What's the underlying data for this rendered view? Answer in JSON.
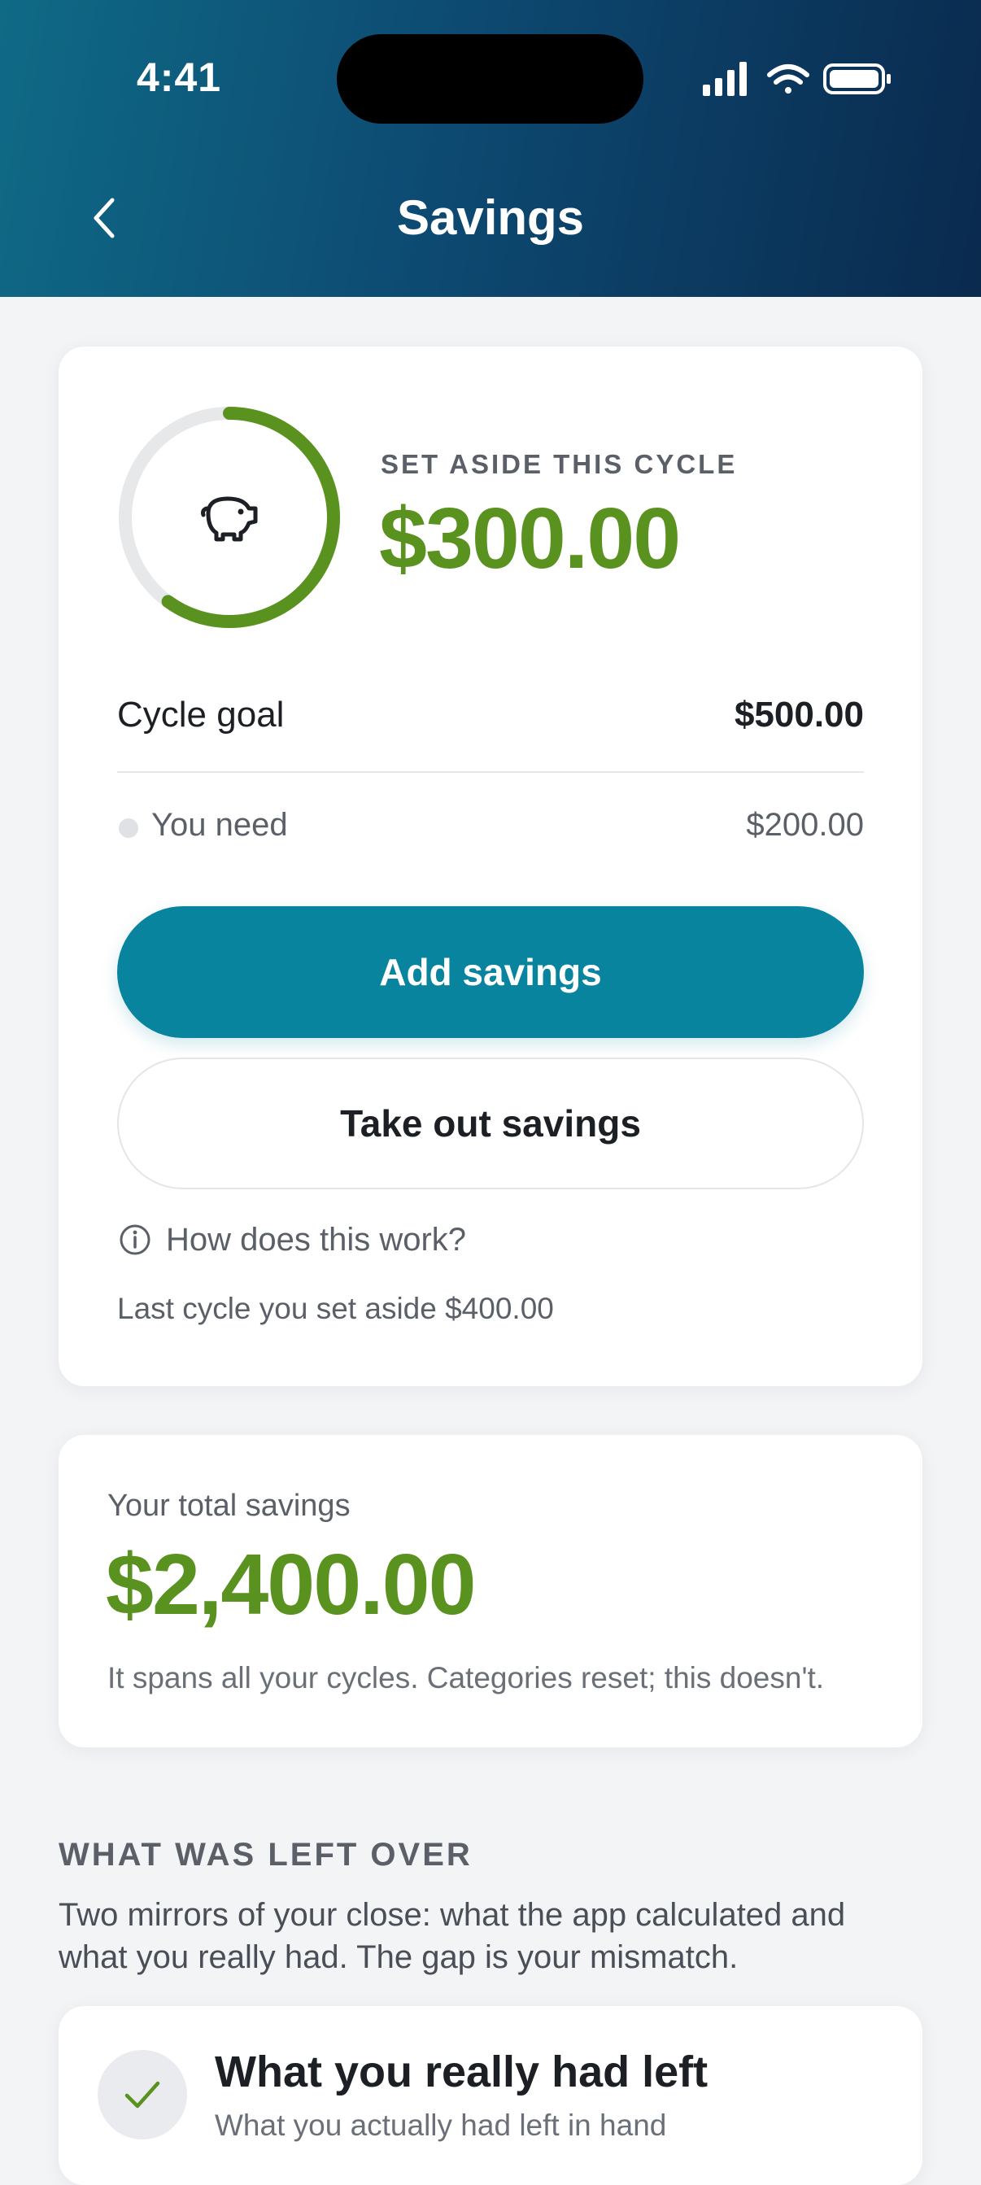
{
  "status_bar": {
    "time": "4:41"
  },
  "nav": {
    "title": "Savings",
    "back_icon": "chevron-left-icon"
  },
  "set_aside": {
    "label": "SET ASIDE THIS CYCLE",
    "amount": "$300.00",
    "progress_fraction": 0.6,
    "icon": "piggy-bank-icon"
  },
  "cycle_goal": {
    "label": "Cycle goal",
    "value": "$500.00"
  },
  "you_need": {
    "label": "You need",
    "value": "$200.00"
  },
  "actions": {
    "add_label": "Add savings",
    "take_out_label": "Take out savings"
  },
  "help": {
    "text": "How does this work?",
    "icon": "info-icon"
  },
  "last_cycle": {
    "text": "Last cycle you set aside $400.00"
  },
  "total_savings": {
    "label": "Your total savings",
    "amount": "$2,400.00",
    "note": "It spans all your cycles. Categories reset; this doesn't."
  },
  "left_over": {
    "title": "WHAT WAS LEFT OVER",
    "description": "Two mirrors of your close: what the app calculated and what you really had. The gap is your mismatch.",
    "card": {
      "title": "What you really had left",
      "subtitle": "What you actually had left in hand",
      "icon": "check-icon"
    }
  },
  "colors": {
    "accent_green": "#5a9220",
    "primary_teal": "#08849f",
    "header_start": "#0f6a86",
    "header_end": "#0a2a4e"
  }
}
